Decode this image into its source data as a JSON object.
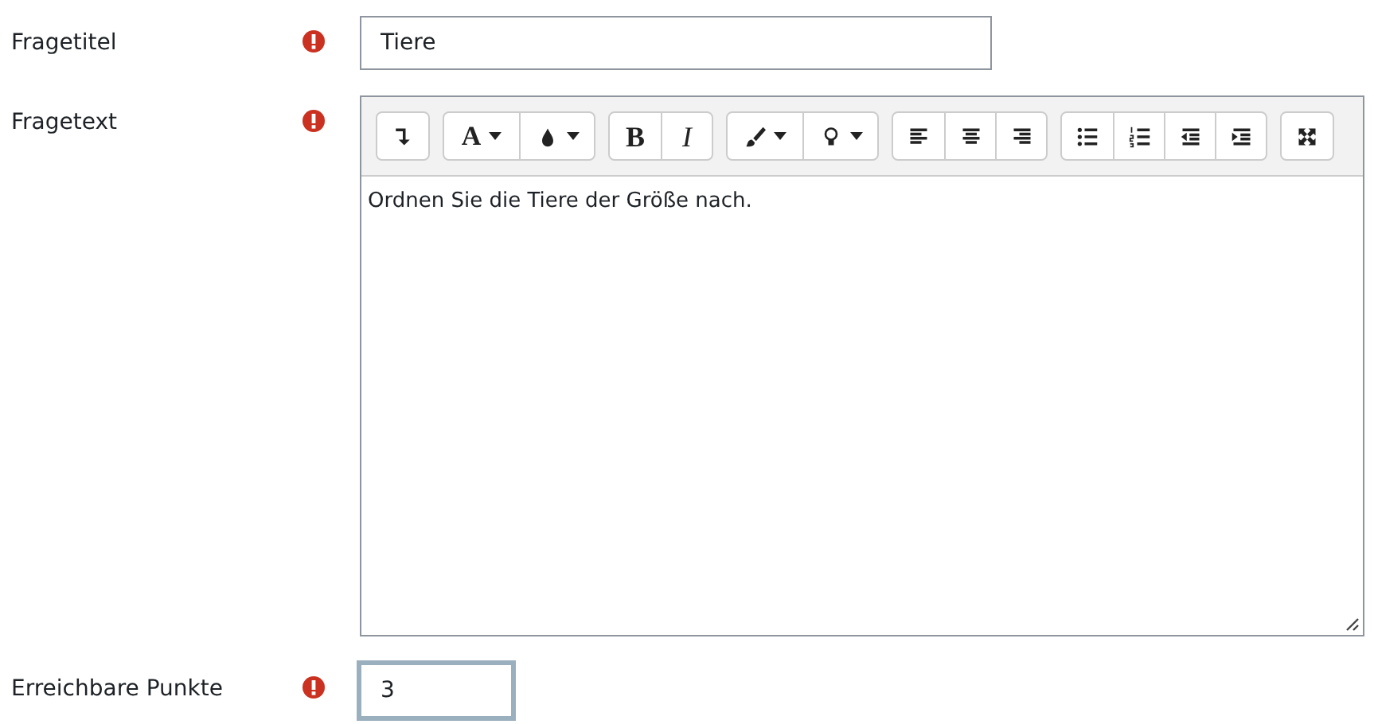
{
  "fields": [
    {
      "kind": "text",
      "label": "Fragetitel",
      "required": true,
      "value": "Tiere",
      "focused": false
    },
    {
      "kind": "editor",
      "label": "Fragetext",
      "required": true,
      "value": "Ordnen Sie die Tiere der Größe nach.",
      "toolbar": [
        [
          {
            "kind": "collapse",
            "dropdown": false
          }
        ],
        [
          {
            "kind": "font",
            "label": "A",
            "dropdown": true
          },
          {
            "kind": "color",
            "dropdown": true
          }
        ],
        [
          {
            "kind": "bold",
            "label": "B",
            "dropdown": false
          },
          {
            "kind": "italic",
            "label": "I",
            "dropdown": false
          }
        ],
        [
          {
            "kind": "brush",
            "dropdown": true
          },
          {
            "kind": "bulb",
            "dropdown": true
          }
        ],
        [
          {
            "kind": "align-left",
            "dropdown": false
          },
          {
            "kind": "align-center",
            "dropdown": false
          },
          {
            "kind": "align-right",
            "dropdown": false
          }
        ],
        [
          {
            "kind": "bullets",
            "dropdown": false
          },
          {
            "kind": "numbers",
            "dropdown": false
          },
          {
            "kind": "outdent",
            "dropdown": false
          },
          {
            "kind": "indent",
            "dropdown": false
          }
        ],
        [
          {
            "kind": "fullscreen",
            "dropdown": false
          }
        ]
      ]
    },
    {
      "kind": "short",
      "label": "Erreichbare Punkte",
      "required": true,
      "value": "3",
      "focused": true
    }
  ]
}
